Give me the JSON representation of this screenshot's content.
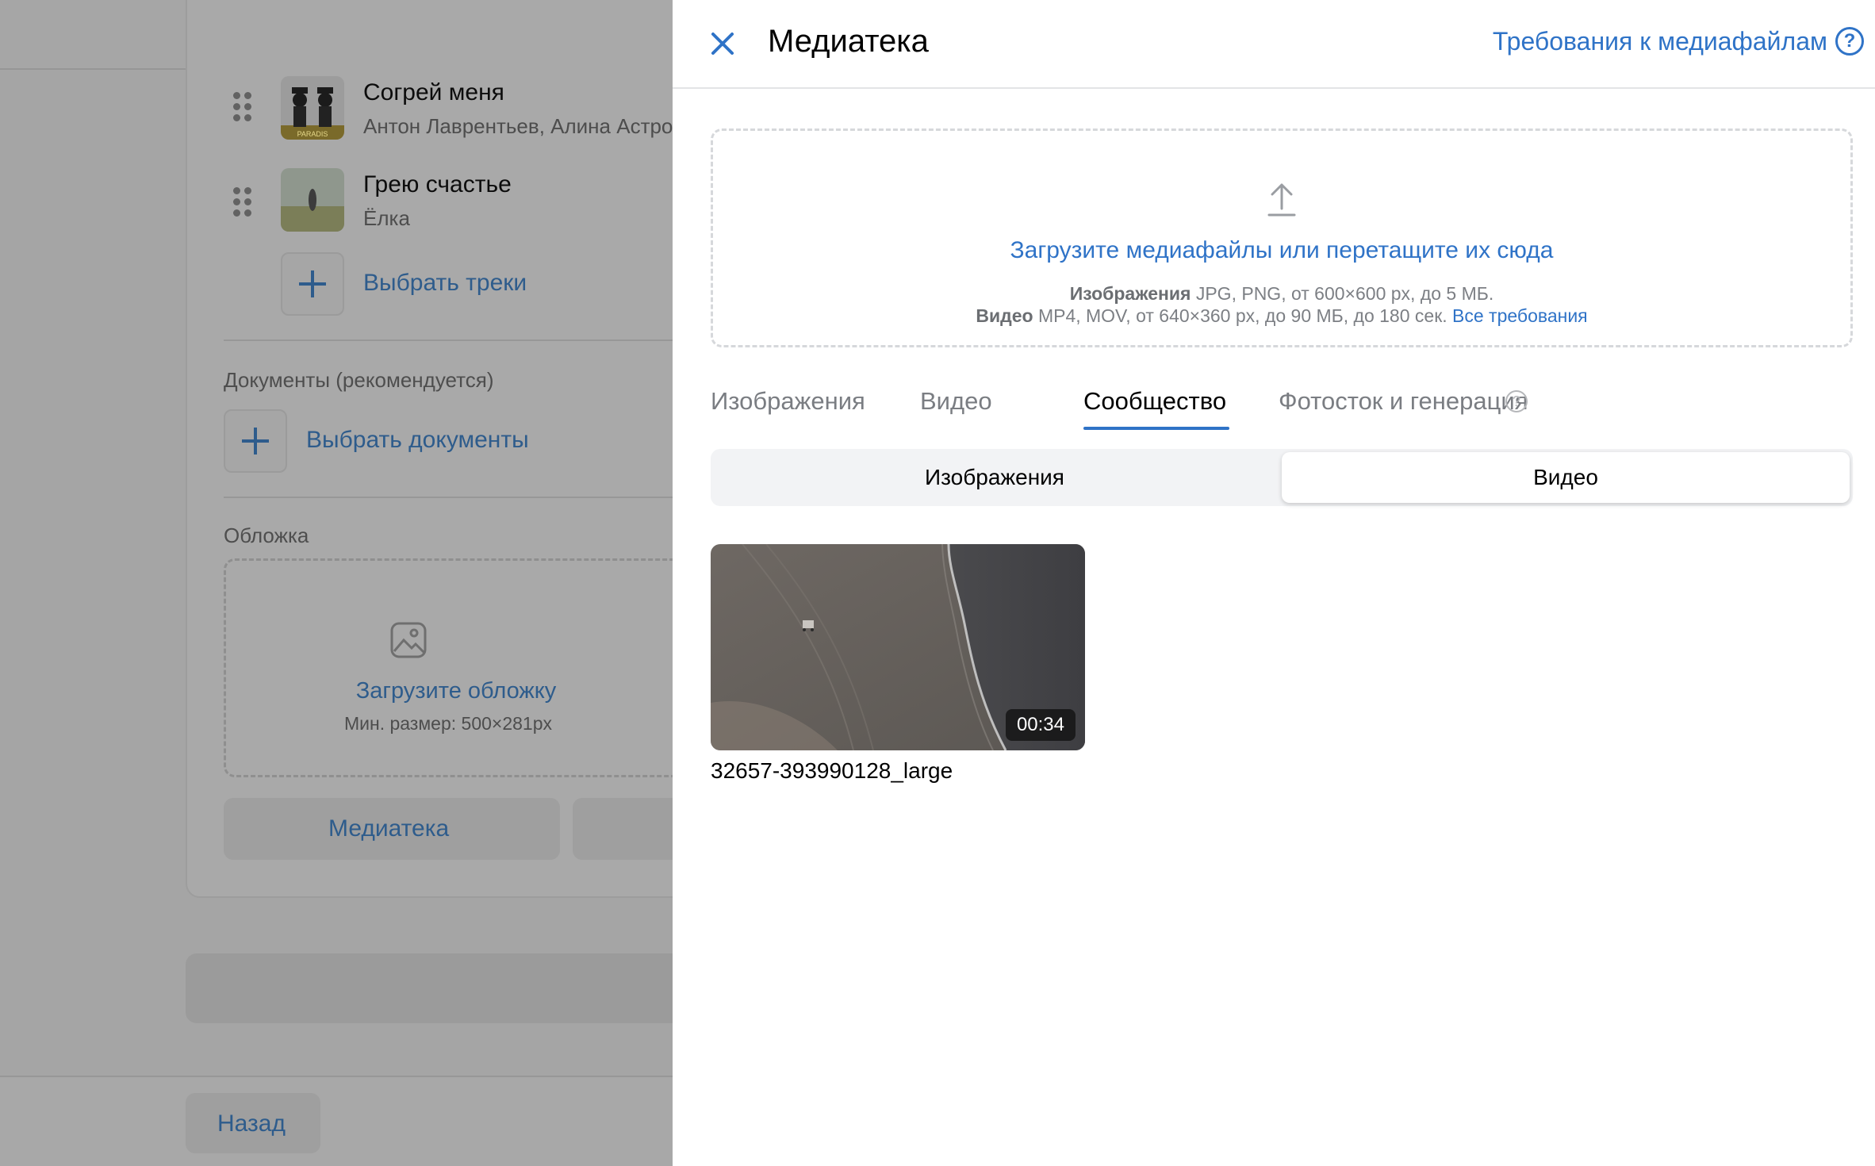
{
  "background": {
    "tracks": [
      {
        "title": "Согрей меня",
        "artist": "Антон Лаврентьев, Алина Астровская"
      },
      {
        "title": "Грею счастье",
        "artist": "Ёлка"
      }
    ],
    "cover_caption": "PARADIS",
    "select_tracks_label": "Выбрать треки",
    "documents_label": "Документы (рекомендуется)",
    "select_documents_label": "Выбрать документы",
    "cover_section_label": "Обложка",
    "cover_upload_link": "Загрузите обложку",
    "cover_min_size": "Мин. размер: 500×281px",
    "media_library_button": "Медиатека",
    "back_button": "Назад"
  },
  "panel": {
    "title": "Медиатека",
    "requirements_link": "Требования к медиафайлам",
    "requirements_icon": "?",
    "dropzone": {
      "title": "Загрузите медиафайлы или перетащите их сюда",
      "images_label": "Изображения",
      "images_spec": "JPG, PNG, от 600×600 px, до 5 МБ.",
      "video_label": "Видео",
      "video_spec": "MP4, MOV, от 640×360 px, до 90 МБ, до 180 сек.",
      "all_requirements_link": "Все требования"
    },
    "tabs": [
      {
        "label": "Изображения",
        "active": false
      },
      {
        "label": "Видео",
        "active": false
      },
      {
        "label": "Сообщество",
        "active": true
      },
      {
        "label": "Фотосток и генерация",
        "active": false
      }
    ],
    "tab_help_icon": "?",
    "segments": [
      {
        "label": "Изображения",
        "selected": false
      },
      {
        "label": "Видео",
        "selected": true
      }
    ],
    "videos": [
      {
        "name": "32657-393990128_large",
        "duration": "00:34"
      }
    ]
  },
  "colors": {
    "accent": "#2f73c7",
    "overlay": "#a5a5a5",
    "panel_bg": "#ffffff"
  }
}
